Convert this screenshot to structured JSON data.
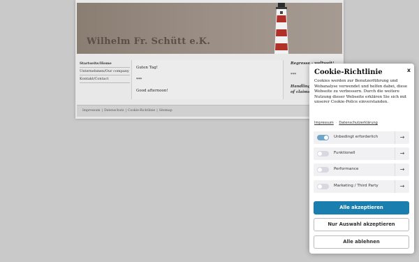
{
  "site": {
    "title": "Wilhelm Fr. Schütt e.K.",
    "nav": [
      {
        "label": "Startseite/Home",
        "active": true
      },
      {
        "label": "Unternehmen/Our company",
        "active": false
      },
      {
        "label": "Kontakt/Contact",
        "active": false
      }
    ],
    "main": {
      "greeting_de": "Guten Tag!",
      "separator1": "***",
      "greeting_en": "Good afternoon!"
    },
    "side": {
      "line1": "Regresse - weltweit!",
      "separator": "***",
      "line2": "Handling",
      "line3": "of claims -"
    },
    "footer": [
      "Impressum",
      "Datenschutz",
      "Cookie-Richtlinie",
      "Sitemap"
    ]
  },
  "cookie": {
    "title": "Cookie-Richtlinie",
    "close": "x",
    "text": "Cookies werden zur Benutzerführung und Webanalyse verwendet und helfen dabei, diese Webseite zu verbessern. Durch die weitere Nutzung dieser Webseite erklären Sie sich mit unserer Cookie-Police einverstanden.",
    "links": [
      "Impressum",
      "Datenschutzerklärung"
    ],
    "categories": [
      {
        "label": "Unbedingt erforderlich",
        "enabled": true
      },
      {
        "label": "Funktionell",
        "enabled": false
      },
      {
        "label": "Performance",
        "enabled": false
      },
      {
        "label": "Marketing / Third Party",
        "enabled": false
      }
    ],
    "arrow": "→",
    "accept_all": "Alle akzeptieren",
    "accept_selection": "Nur Auswahl akzeptieren",
    "reject_all": "Alle ablehnen",
    "colors": {
      "primary": "#1a7fae",
      "toggle_on": "#6ea6c8"
    }
  }
}
